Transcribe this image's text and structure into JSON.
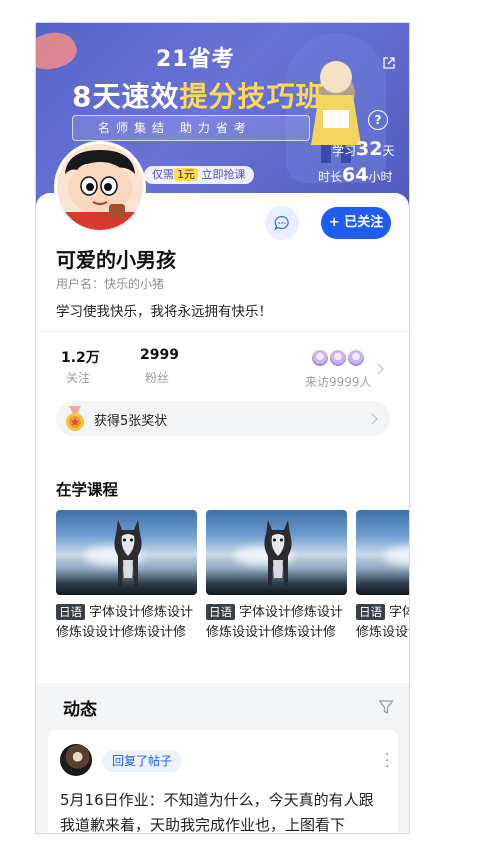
{
  "banner": {
    "title1": "21省考",
    "title2_part1": "8天速效",
    "title2_part2": "提分技巧班",
    "tagline": "名师集结 助力省考",
    "price_prefix": "仅需",
    "price_value": "1元",
    "price_suffix": "立即抢课",
    "study_days_prefix": "学习",
    "study_days_value": "32",
    "study_days_unit": "天",
    "study_hours_prefix": "时长",
    "study_hours_value": "64",
    "study_hours_unit": "小时",
    "help_glyph": "?"
  },
  "profile": {
    "nickname": "可爱的小男孩",
    "username": "用户名：快乐的小猪",
    "bio": "学习使我快乐，我将永远拥有快乐！",
    "follow_label": "+ 已关注"
  },
  "stats": {
    "following_count": "1.2万",
    "following_label": "关注",
    "fans_count": "2999",
    "fans_label": "粉丝",
    "visitors_label": "来访9999人"
  },
  "award": {
    "label": "获得5张奖状"
  },
  "courses": {
    "section_title": "在学课程",
    "items": [
      {
        "tag": "日语",
        "title": "字体设计修炼设计修炼设设计修炼设计修炼设..."
      },
      {
        "tag": "日语",
        "title": "字体设计修炼设计修炼设设计修炼设计修炼设..."
      },
      {
        "tag": "日语",
        "title": "字体设计修炼设计修炼设设计修炼设计修炼设..."
      }
    ]
  },
  "feed": {
    "title": "动态",
    "post": {
      "badge": "回复了帖子",
      "text": "5月16日作业：不知道为什么，今天真的有人跟我道歉来着，天助我完成作业也，上图看下"
    }
  },
  "colors": {
    "accent": "#1f5cf2",
    "banner": "#5564c8",
    "highlight": "#ffd95a"
  }
}
